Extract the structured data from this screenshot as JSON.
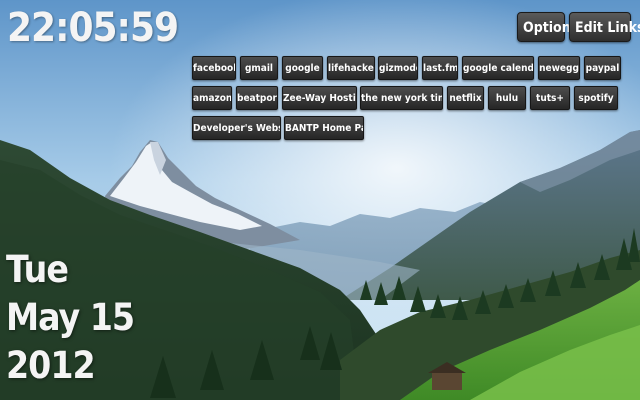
{
  "clock": {
    "time": "22:05:59"
  },
  "date": {
    "weekday": "Tue",
    "month_day": "May 15",
    "year": "2012"
  },
  "header": {
    "options_label": "Options",
    "edit_links_label": "Edit Links"
  },
  "links": [
    [
      "facebook",
      "gmail",
      "google",
      "lifehacker",
      "gizmodo",
      "last.fm",
      "google calendar",
      "newegg",
      "paypal"
    ],
    [
      "amazon",
      "beatport",
      "Zee-Way Hosting",
      "the new york times",
      "netflix",
      "hulu",
      "tuts+",
      "spotify"
    ],
    [
      "Developer's Website",
      "BANTP Home Page"
    ]
  ],
  "colors": {
    "button_top": "#4d4d4d",
    "button_bottom": "#262626",
    "text": "#ffffff"
  }
}
